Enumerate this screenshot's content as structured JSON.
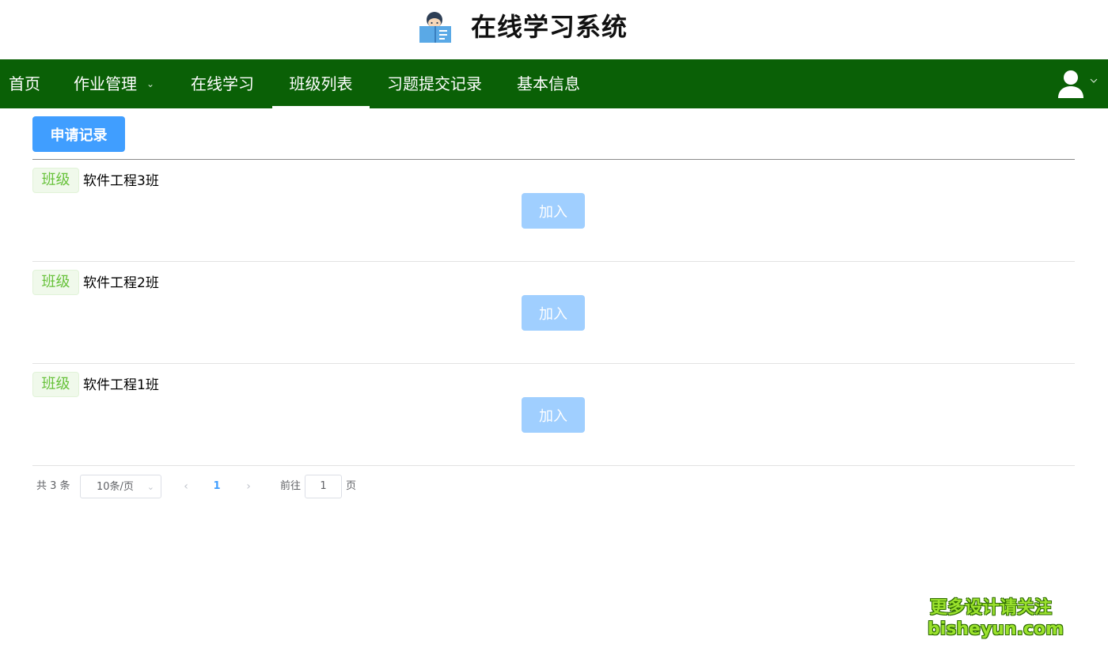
{
  "header": {
    "title": "在线学习系统",
    "logo_icon": "reading-student-icon"
  },
  "nav": {
    "items": [
      {
        "label": "首页",
        "active": false
      },
      {
        "label": "作业管理",
        "active": false,
        "has_dropdown": true
      },
      {
        "label": "在线学习",
        "active": false
      },
      {
        "label": "班级列表",
        "active": true
      },
      {
        "label": "习题提交记录",
        "active": false
      },
      {
        "label": "基本信息",
        "active": false
      }
    ],
    "user_icon": "user-avatar-icon",
    "background": "#0a6006"
  },
  "toolbar": {
    "apply_records_label": "申请记录",
    "accent": "#409eff"
  },
  "classes": [
    {
      "tag": "班级",
      "name": "软件工程3班",
      "join_label": "加入",
      "join_enabled": false
    },
    {
      "tag": "班级",
      "name": "软件工程2班",
      "join_label": "加入",
      "join_enabled": false
    },
    {
      "tag": "班级",
      "name": "软件工程1班",
      "join_label": "加入",
      "join_enabled": false
    }
  ],
  "pagination": {
    "total": "共 3 条",
    "page_size": "10条/页",
    "current_page": "1",
    "goto_label": "前往",
    "goto_value": "1",
    "page_suffix": "页"
  },
  "watermark": {
    "line1": "更多设计请关注",
    "line2": "bisheyun.com"
  }
}
